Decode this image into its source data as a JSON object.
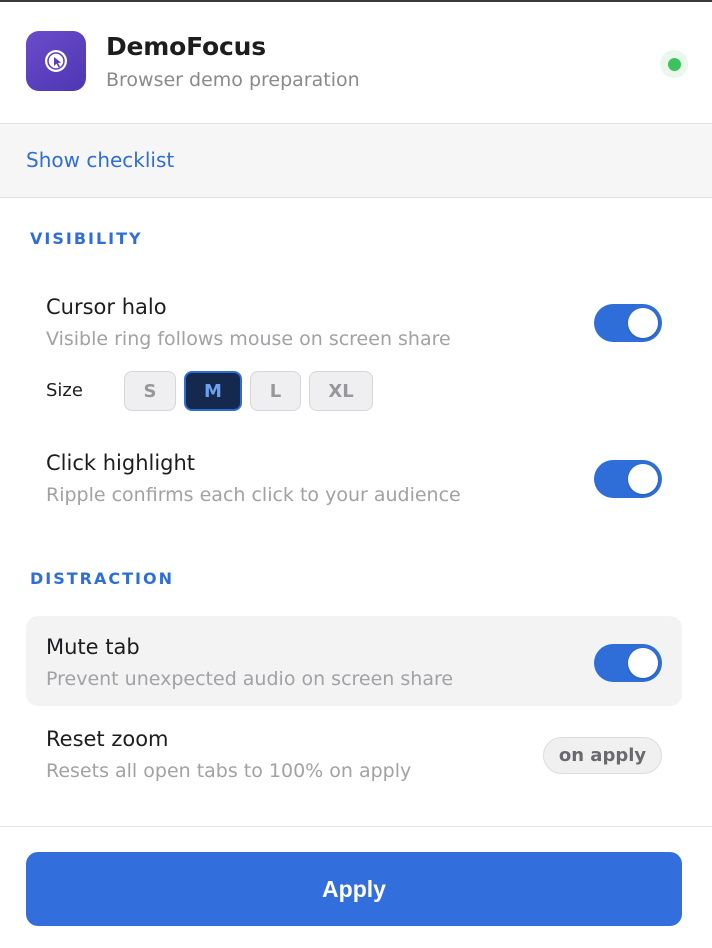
{
  "app": {
    "title": "DemoFocus",
    "subtitle": "Browser demo preparation",
    "icon": "cursor-click-icon",
    "status": "active",
    "status_color": "#3cc35b",
    "accent": "#2f6ed8"
  },
  "checklist": {
    "label": "Show checklist"
  },
  "sections": {
    "visibility": {
      "title": "VISIBILITY",
      "cursor_halo": {
        "title": "Cursor halo",
        "desc": "Visible ring follows mouse on screen share",
        "enabled": true,
        "size_label": "Size",
        "sizes": [
          "S",
          "M",
          "L",
          "XL"
        ],
        "selected_size": "M"
      },
      "click_highlight": {
        "title": "Click highlight",
        "desc": "Ripple confirms each click to your audience",
        "enabled": true
      }
    },
    "distraction": {
      "title": "DISTRACTION",
      "mute_tab": {
        "title": "Mute tab",
        "desc": "Prevent unexpected audio on screen share",
        "enabled": true
      },
      "reset_zoom": {
        "title": "Reset zoom",
        "desc": "Resets all open tabs to 100% on apply",
        "badge": "on apply"
      }
    }
  },
  "footer": {
    "apply_label": "Apply"
  }
}
